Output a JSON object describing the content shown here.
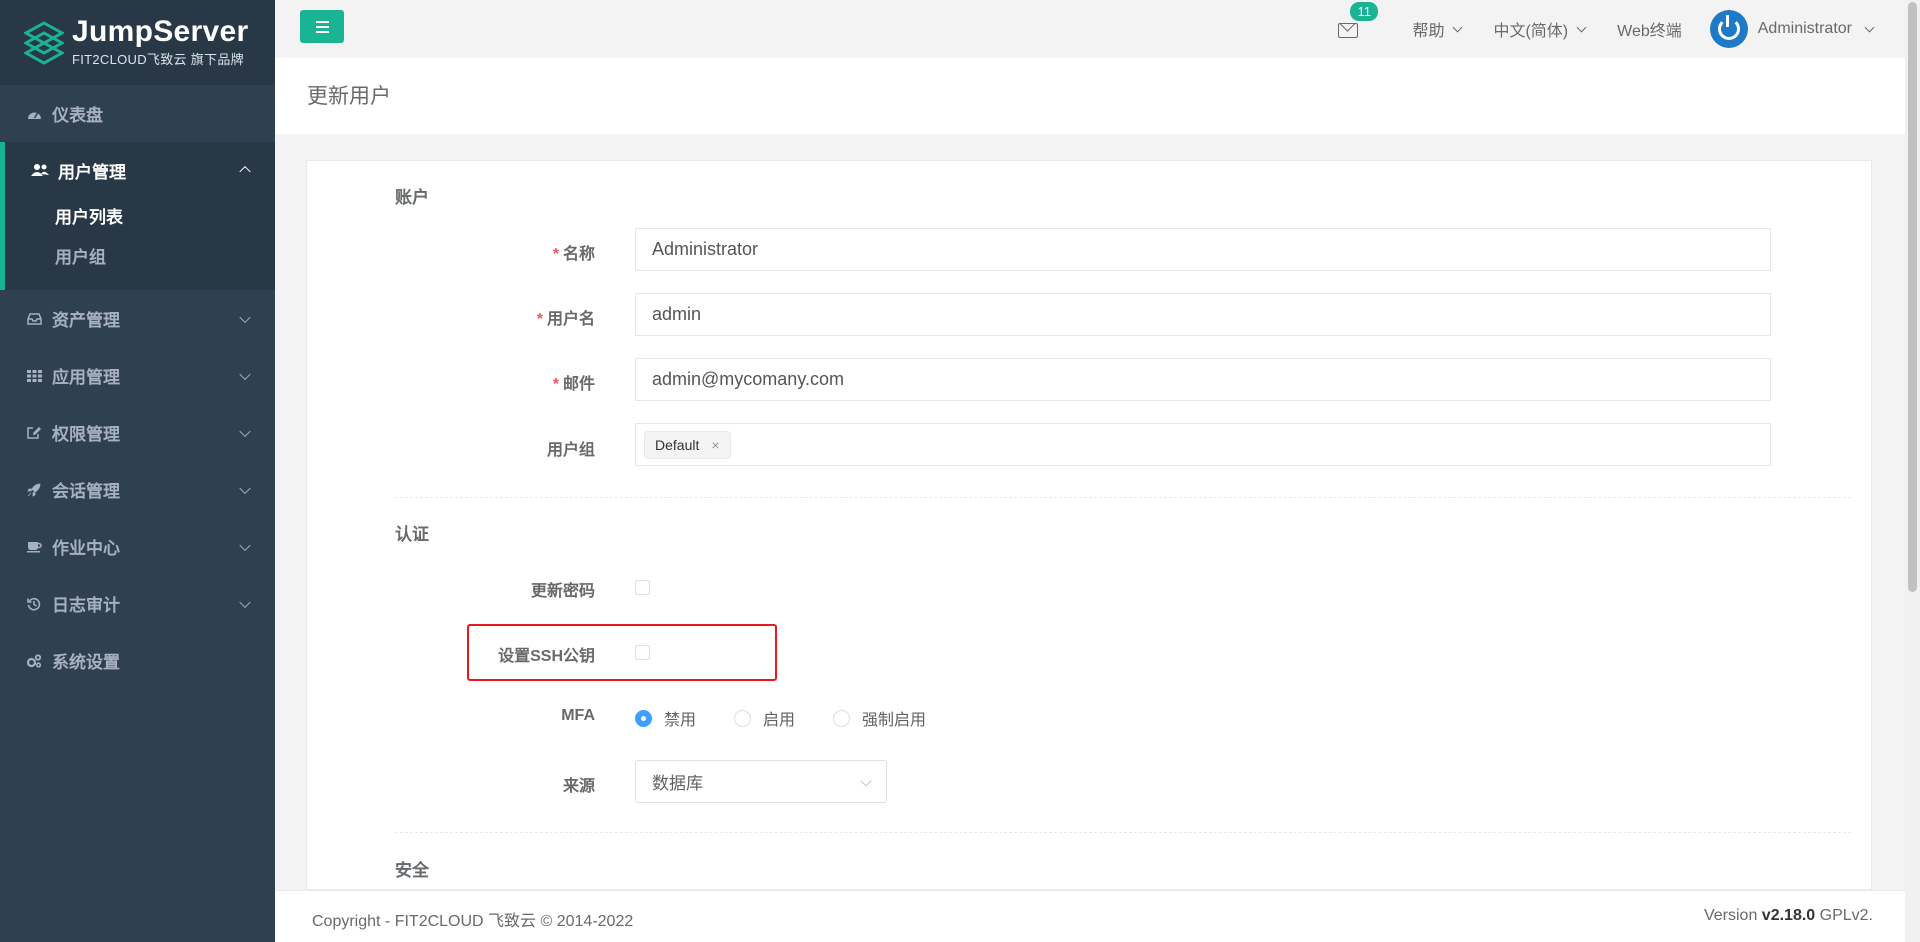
{
  "brand": {
    "title": "JumpServer",
    "subtitle": "FIT2CLOUD飞致云 旗下品牌"
  },
  "sidebar": {
    "items": [
      {
        "label": "仪表盘",
        "icon": "dashboard-icon"
      },
      {
        "label": "用户管理",
        "icon": "users-icon",
        "expanded": true,
        "children": [
          {
            "label": "用户列表",
            "active": true
          },
          {
            "label": "用户组"
          }
        ]
      },
      {
        "label": "资产管理",
        "icon": "inbox-icon"
      },
      {
        "label": "应用管理",
        "icon": "grid-icon"
      },
      {
        "label": "权限管理",
        "icon": "edit-icon"
      },
      {
        "label": "会话管理",
        "icon": "rocket-icon"
      },
      {
        "label": "作业中心",
        "icon": "coffee-icon"
      },
      {
        "label": "日志审计",
        "icon": "history-icon"
      },
      {
        "label": "系统设置",
        "icon": "gears-icon"
      }
    ]
  },
  "topbar": {
    "mail_badge": "11",
    "help": "帮助",
    "language": "中文(简体)",
    "web_terminal": "Web终端",
    "user": "Administrator"
  },
  "page": {
    "title": "更新用户"
  },
  "form": {
    "account_section": "账户",
    "name_label": "名称",
    "name_value": "Administrator",
    "username_label": "用户名",
    "username_value": "admin",
    "email_label": "邮件",
    "email_value": "admin@mycomany.com",
    "group_label": "用户组",
    "group_tag": "Default",
    "group_tag_close": "×",
    "required_mark": "*",
    "auth_section": "认证",
    "update_password_label": "更新密码",
    "ssh_key_label": "设置SSH公钥",
    "mfa_label": "MFA",
    "mfa_options": [
      "禁用",
      "启用",
      "强制启用"
    ],
    "mfa_selected": "禁用",
    "source_label": "来源",
    "source_value": "数据库",
    "security_section": "安全"
  },
  "footer": {
    "copyright": "Copyright - FIT2CLOUD 飞致云 © 2014-2022",
    "version_prefix": "Version ",
    "version": "v2.18.0",
    "license": " GPLv2."
  },
  "colors": {
    "accent": "#1ab394",
    "sidebar_bg": "#2f4050",
    "highlight_box": "#e8181d",
    "radio_checked": "#409eff"
  }
}
